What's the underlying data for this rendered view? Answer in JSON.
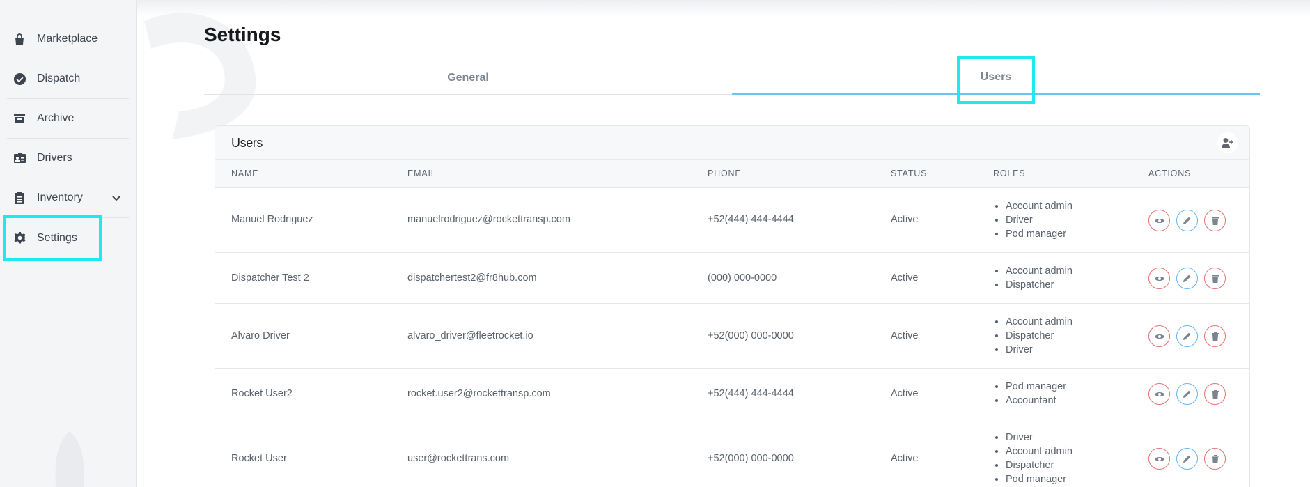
{
  "sidebar": {
    "items": [
      {
        "label": "Marketplace",
        "icon": "bag-icon"
      },
      {
        "label": "Dispatch",
        "icon": "check-circle-icon"
      },
      {
        "label": "Archive",
        "icon": "archive-box-icon"
      },
      {
        "label": "Drivers",
        "icon": "id-card-icon"
      },
      {
        "label": "Inventory",
        "icon": "clipboard-icon"
      },
      {
        "label": "Settings",
        "icon": "gear-icon"
      }
    ]
  },
  "page": {
    "title": "Settings"
  },
  "tabs": [
    {
      "label": "General"
    },
    {
      "label": "Users"
    }
  ],
  "users_card": {
    "title": "Users",
    "add_icon": "add-user-icon",
    "columns": [
      "NAME",
      "EMAIL",
      "PHONE",
      "STATUS",
      "ROLES",
      "ACTIONS"
    ],
    "rows": [
      {
        "name": "Manuel Rodriguez",
        "email": "manuelrodriguez@rockettransp.com",
        "phone": "+52(444) 444-4444",
        "status": "Active",
        "roles": [
          "Account admin",
          "Driver",
          "Pod manager"
        ]
      },
      {
        "name": "Dispatcher Test 2",
        "email": "dispatchertest2@fr8hub.com",
        "phone": "(000) 000-0000",
        "status": "Active",
        "roles": [
          "Account admin",
          "Dispatcher"
        ]
      },
      {
        "name": "Alvaro Driver",
        "email": "alvaro_driver@fleetrocket.io",
        "phone": "+52(000) 000-0000",
        "status": "Active",
        "roles": [
          "Account admin",
          "Dispatcher",
          "Driver"
        ]
      },
      {
        "name": "Rocket User2",
        "email": "rocket.user2@rockettransp.com",
        "phone": "+52(444) 444-4444",
        "status": "Active",
        "roles": [
          "Pod manager",
          "Accountant"
        ]
      },
      {
        "name": "Rocket User",
        "email": "user@rockettrans.com",
        "phone": "+52(000) 000-0000",
        "status": "Active",
        "roles": [
          "Driver",
          "Account admin",
          "Dispatcher",
          "Pod manager"
        ]
      }
    ]
  },
  "colors": {
    "highlight": "#1de9ef",
    "tab_underline": "#6bc6ee",
    "view_delete": "#e57373",
    "edit": "#64b5f6"
  }
}
